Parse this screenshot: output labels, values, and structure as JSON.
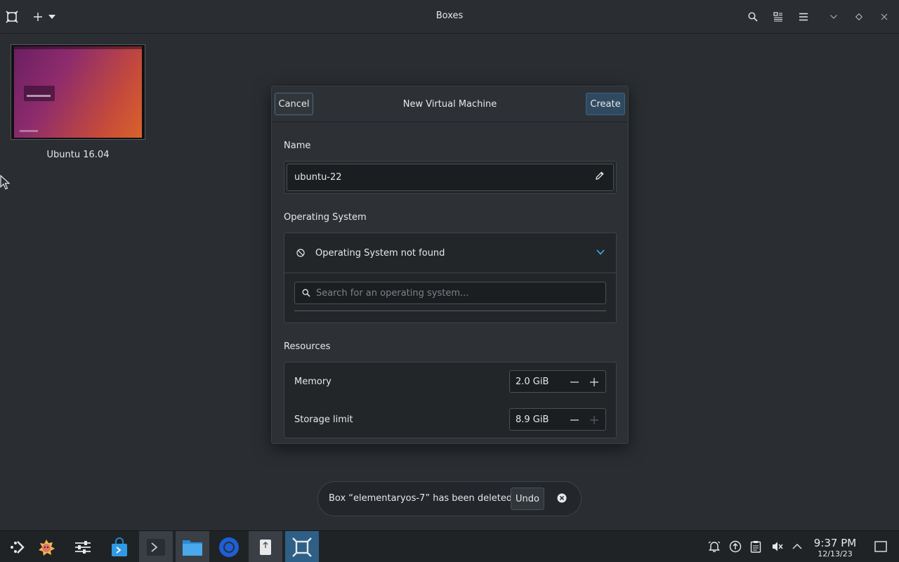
{
  "window": {
    "title": "Boxes"
  },
  "boxes": [
    {
      "label": "Ubuntu 16.04"
    }
  ],
  "dialog": {
    "title": "New Virtual Machine",
    "cancel_label": "Cancel",
    "create_label": "Create",
    "name_section": "Name",
    "name_value": "ubuntu-22",
    "os_section": "Operating System",
    "os_status": "Operating System not found",
    "os_search_placeholder": "Search for an operating system...",
    "resources_section": "Resources",
    "memory_label": "Memory",
    "memory_value": "2.0 GiB",
    "storage_label": "Storage limit",
    "storage_value": "8.9 GiB"
  },
  "toast": {
    "message": "Box “elementaryos-7” has been deleted",
    "undo_label": "Undo"
  },
  "taskbar": {
    "time": "9:37 PM",
    "date": "12/13/23"
  },
  "colors": {
    "accent": "#3daee9",
    "active_task": "#2e5f86"
  }
}
